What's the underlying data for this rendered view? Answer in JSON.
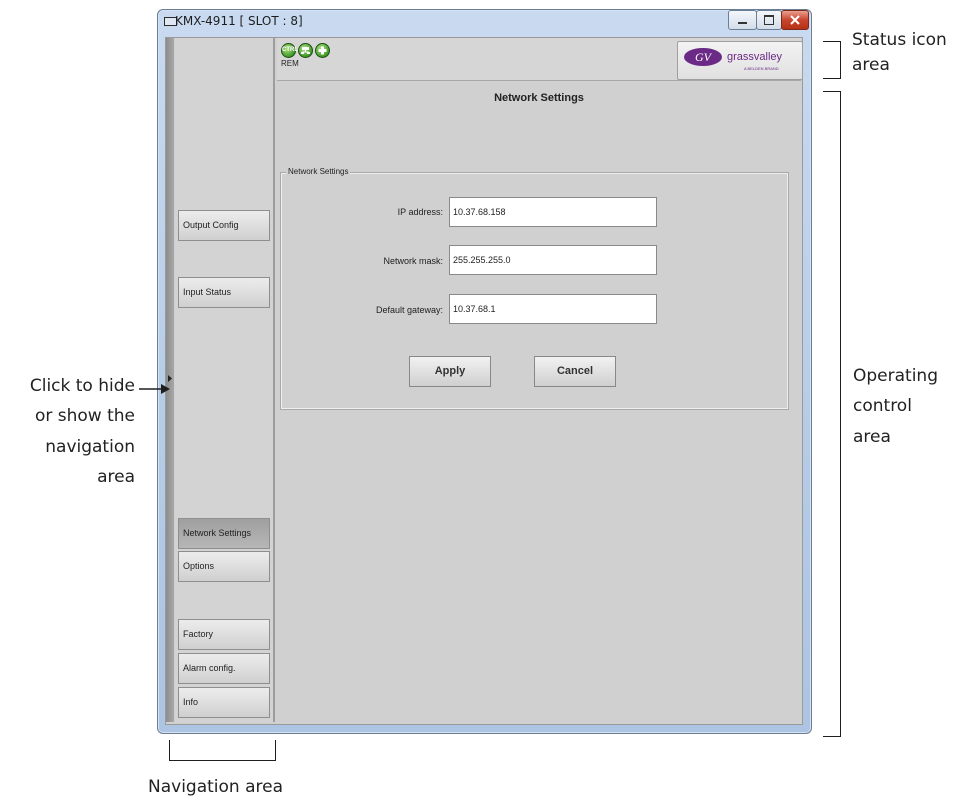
{
  "window": {
    "title": "KMX-4911 [ SLOT : 8]"
  },
  "status_icons": {
    "ctrl_label": "CTRL",
    "rem_label": "REM",
    "logo_text": "grassvalley",
    "logo_sub": "A BELDEN BRAND"
  },
  "sidebar": {
    "items": [
      {
        "label": "Output Config"
      },
      {
        "label": "Input Status"
      },
      {
        "label": "Network Settings"
      },
      {
        "label": "Options"
      },
      {
        "label": "Factory"
      },
      {
        "label": "Alarm config."
      },
      {
        "label": "Info"
      }
    ],
    "active": "Network Settings"
  },
  "main": {
    "title": "Network Settings",
    "group_label": "Network Settings",
    "fields": [
      {
        "label": "IP address:",
        "value": "10.37.68.158"
      },
      {
        "label": "Network mask:",
        "value": "255.255.255.0"
      },
      {
        "label": "Default gateway:",
        "value": "10.37.68.1"
      }
    ],
    "apply_label": "Apply",
    "cancel_label": "Cancel"
  },
  "annotations": {
    "status_icon_area": [
      "Status icon",
      "area"
    ],
    "operating_control_area": [
      "Operating",
      "control",
      "area"
    ],
    "hide_show": [
      "Click to hide",
      "or show the",
      "navigation",
      "area"
    ],
    "navigation_area": "Navigation area"
  },
  "colors": {
    "status_icon_green": "#3c9a25",
    "logo_purple": "#6b2a86",
    "close_button_red": "#c8442c"
  }
}
